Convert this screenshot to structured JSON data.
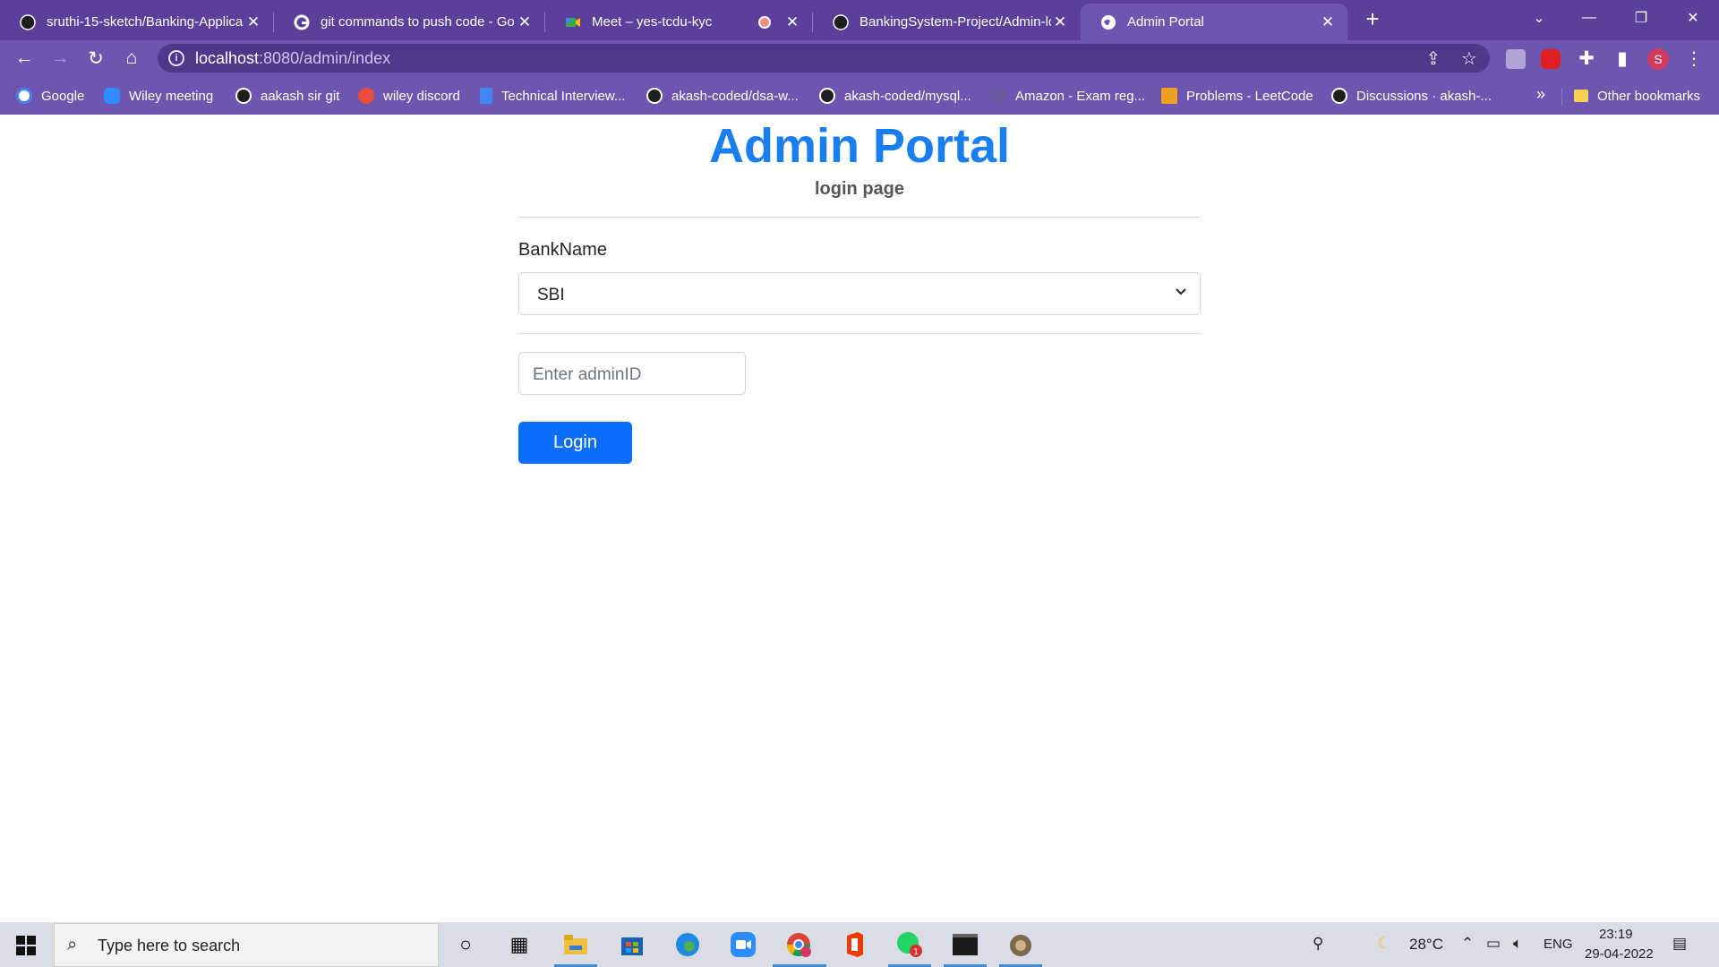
{
  "browser": {
    "tabs": [
      {
        "title": "sruthi-15-sketch/Banking-Applica",
        "icon": "github-icon"
      },
      {
        "title": "git commands to push code - Go",
        "icon": "google-icon"
      },
      {
        "title": "Meet – yes-tcdu-kyc",
        "icon": "meet-icon"
      },
      {
        "title": "BankingSystem-Project/Admin-lo",
        "icon": "github-icon"
      },
      {
        "title": "Admin Portal",
        "icon": "globe-icon"
      }
    ],
    "url_host": "localhost",
    "url_rest": ":8080/admin/index",
    "profile_initial": "S",
    "bookmarks": [
      {
        "label": "Google"
      },
      {
        "label": "Wiley meeting"
      },
      {
        "label": "aakash sir git"
      },
      {
        "label": "wiley discord"
      },
      {
        "label": "Technical Interview..."
      },
      {
        "label": "akash-coded/dsa-w..."
      },
      {
        "label": "akash-coded/mysql..."
      },
      {
        "label": "Amazon - Exam reg..."
      },
      {
        "label": "Problems - LeetCode"
      },
      {
        "label": "Discussions · akash-..."
      }
    ],
    "bookmarks_more": "»",
    "other_bookmarks": "Other bookmarks"
  },
  "page": {
    "title": "Admin Portal",
    "subtitle": "login page",
    "bank_label": "BankName",
    "bank_selected": "SBI",
    "admin_placeholder": "Enter adminID",
    "login_button": "Login"
  },
  "taskbar": {
    "search_placeholder": "Type here to search",
    "temperature": "28°C",
    "language": "ENG",
    "time": "23:19",
    "date": "29-04-2022",
    "whatsapp_badge": "1"
  },
  "colors": {
    "chrome_dark": "#5b3f9a",
    "chrome": "#6e56b0",
    "heading": "#1a7df0",
    "button": "#0d6efd"
  }
}
